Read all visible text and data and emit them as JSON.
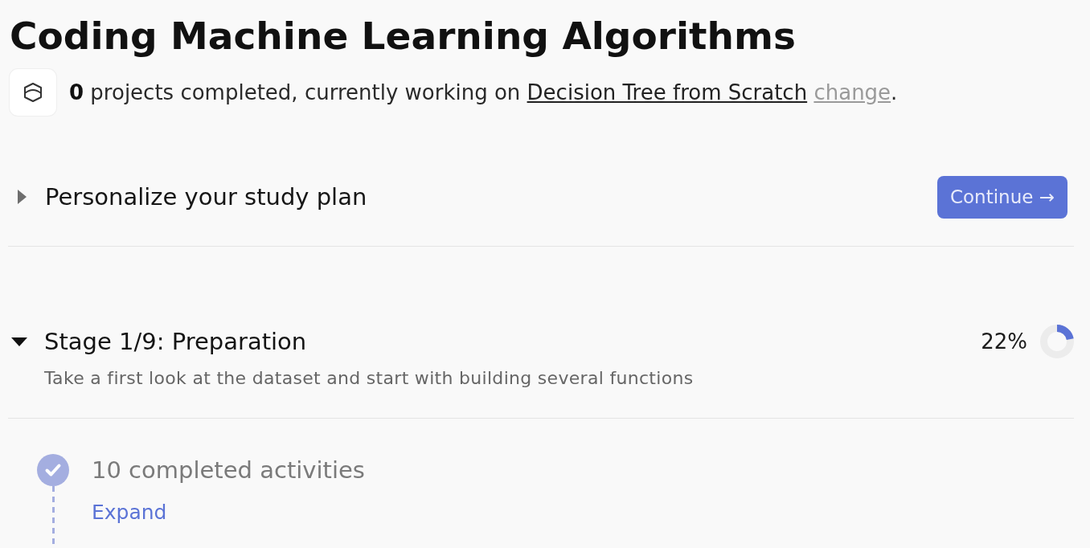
{
  "header": {
    "title": "Coding Machine Learning Algorithms",
    "summary": {
      "text": "**0** projects completed, currently working on",
      "project_link": "Decision Tree from Scratch",
      "change_link": "change",
      "trailing": "."
    }
  },
  "study_plan": {
    "label": "Personalize your study plan",
    "expanded": false,
    "button": "Continue →"
  },
  "stage": {
    "title": "Stage 1/9: Preparation",
    "expanded": true,
    "percent": "22%",
    "level": 0.22,
    "description": "Take a first look at the dataset and start with building several functions"
  },
  "milestones": [
    {
      "label": "10 completed activities",
      "completed": true,
      "link": "Expand"
    }
  ]
}
